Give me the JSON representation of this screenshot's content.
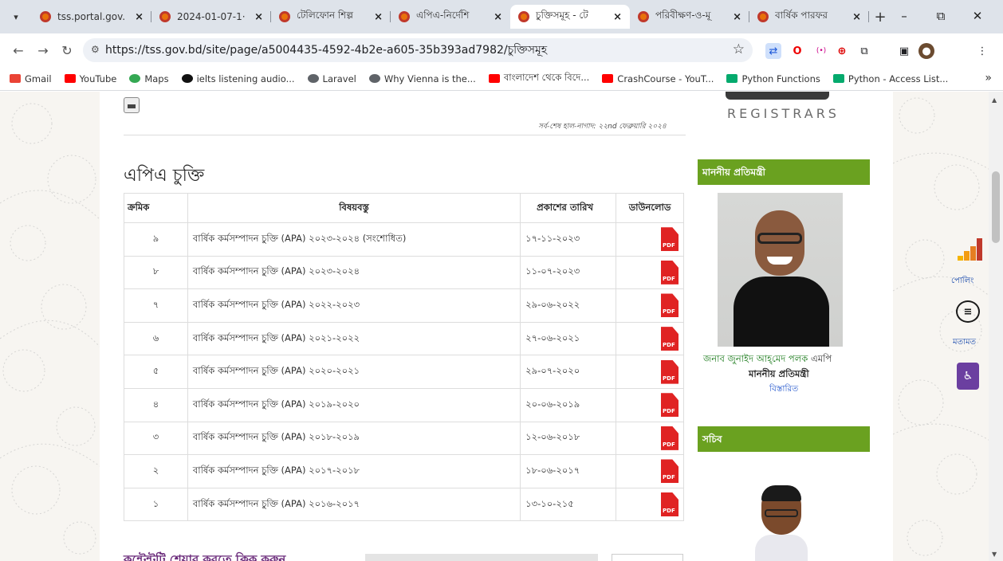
{
  "browser": {
    "tabs": [
      {
        "label": "tss.portal.gov.",
        "active": false
      },
      {
        "label": "2024-01-07-1·",
        "active": false
      },
      {
        "label": "টেলিফোন শিল্প",
        "active": false
      },
      {
        "label": "এপিএ-নির্দেশি",
        "active": false
      },
      {
        "label": "চুক্তিসমূহ - টে",
        "active": true
      },
      {
        "label": "পরিবীক্ষণ-ও-মূ",
        "active": false
      },
      {
        "label": "বার্ষিক পারফর",
        "active": false
      }
    ],
    "url": "https://tss.gov.bd/site/page/a5004435-4592-4b2e-a605-35b393ad7982/চুক্তিসমূহ",
    "bookmarks": [
      {
        "label": "Gmail",
        "color": "#ea4335"
      },
      {
        "label": "YouTube",
        "color": "#ff0000"
      },
      {
        "label": "Maps",
        "color": "#34a853"
      },
      {
        "label": "ielts listening audio...",
        "color": "#111111"
      },
      {
        "label": "Laravel",
        "color": "#5f6368"
      },
      {
        "label": "Why Vienna is the...",
        "color": "#5f6368"
      },
      {
        "label": "বাংলাদেশ থেকে বিদে...",
        "color": "#ff0000"
      },
      {
        "label": "CrashCourse - YouT...",
        "color": "#ff0000"
      },
      {
        "label": "Python Functions",
        "color": "#04aa6d"
      },
      {
        "label": "Python - Access List...",
        "color": "#04aa6d"
      }
    ]
  },
  "page": {
    "last_updated": "সর্ব-শেষ হাল-নাগাদ: ২২nd ফেব্রুয়ারি ২০২৪",
    "title": "এপিএ চুক্তি",
    "table": {
      "headers": [
        "ক্রমিক",
        "বিষয়বস্তু",
        "প্রকাশের তারিখ",
        "ডাউনলোড"
      ],
      "rows": [
        {
          "serial": "৯",
          "subject": "বার্ষিক কর্মসম্পাদন চুক্তি (APA)   ২০২৩-২০২৪ (সংশোধিত)",
          "date": "১৭-১১-২০২৩"
        },
        {
          "serial": "৮",
          "subject": "বার্ষিক কর্মসম্পাদন চুক্তি (APA)   ২০২৩-২০২৪",
          "date": "১১-০৭-২০২৩"
        },
        {
          "serial": "৭",
          "subject": "বার্ষিক কর্মসম্পাদন চুক্তি (APA)   ২০২২-২০২৩",
          "date": "২৯-০৬-২০২২"
        },
        {
          "serial": "৬",
          "subject": "বার্ষিক কর্মসম্পাদন চুক্তি (APA)   ২০২১-২০২২",
          "date": "২৭-০৬-২০২১"
        },
        {
          "serial": "৫",
          "subject": "বার্ষিক কর্মসম্পাদন চুক্তি (APA)    ২০২০-২০২১",
          "date": "২৯-০৭-২০২০"
        },
        {
          "serial": "৪",
          "subject": "বার্ষিক কর্মসম্পাদন চুক্তি (APA)   ২০১৯-২০২০",
          "date": "২০-০৬-২০১৯"
        },
        {
          "serial": "৩",
          "subject": "বার্ষিক কর্মসম্পাদন চুক্তি (APA)    ২০১৮-২০১৯",
          "date": "১২-০৬-২০১৮"
        },
        {
          "serial": "২",
          "subject": "বার্ষিক কর্মসম্পাদন চুক্তি (APA)   ২০১৭-২০১৮",
          "date": "১৮-০৬-২০১৭"
        },
        {
          "serial": "১",
          "subject": "বার্ষিক কর্মসম্পাদন চুক্তি (APA)   ২০১৬-২০১৭",
          "date": "১৩-১০-২১৫"
        }
      ],
      "pdf_label": "PDF"
    },
    "footer_link": "কন্টেন্টটি শেয়ার করতে ক্লিক করুন"
  },
  "sidebar": {
    "logo_text": "REGISTRARS",
    "minister_heading": "মাননীয় প্রতিমন্ত্রী",
    "minister_name": "জনাব জুনাইদ আহ্‌মেদ পলক",
    "minister_suffix": "এমপি",
    "minister_title": "মাননীয় প্রতিমন্ত্রী",
    "minister_more": "বিস্তারিত",
    "secretary_heading": "সচিব"
  },
  "widgets": {
    "poll_label": "পোলিং",
    "feedback_label": "মতামত"
  },
  "colors": {
    "accent_green": "#6aa120",
    "pdf_red": "#e02323",
    "accessibility_purple": "#6b3fa0"
  }
}
